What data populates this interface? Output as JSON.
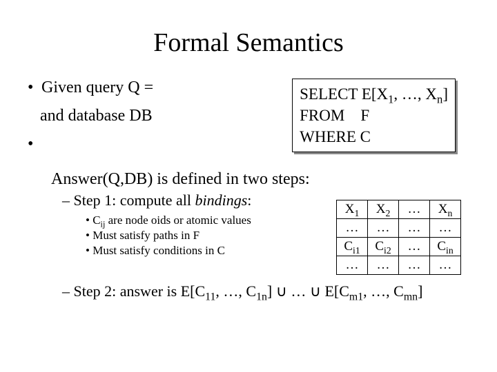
{
  "title": "Formal Semantics",
  "given_query": "Given query Q =",
  "and_database": "and database DB",
  "sql": {
    "select_kw": "SELECT",
    "select_expr_pre": "E[X",
    "select_expr_mid": ", …, X",
    "select_expr_post": "]",
    "from_kw": "FROM",
    "from_val": "F",
    "where_kw": "WHERE",
    "where_val": "C"
  },
  "answer_line": "Answer(Q,DB) is defined in two steps:",
  "step1": {
    "label": "– Step 1: compute all ",
    "bindings": "bindings",
    "colon": ":",
    "sub_a_pre": "C",
    "sub_a_post": " are node oids or atomic values",
    "sub_b": "Must satisfy paths in F",
    "sub_c": "Must satisfy conditions in C"
  },
  "table": {
    "h1": "X",
    "h2": "X",
    "hdots": "…",
    "hn": "X",
    "r_dots": "…",
    "c1": "C",
    "c2": "C",
    "cdots": "…",
    "cn": "C"
  },
  "step2": {
    "label": "– Step 2: answer is E[C",
    "mid1": ", …, C",
    "close1": "]",
    "cup": " ∪ … ∪ ",
    "open2": "E[C",
    "mid2": ", …, C",
    "close2": "]"
  },
  "subscripts": {
    "one": "1",
    "two": "2",
    "n": "n",
    "ij": "ij",
    "i1": "i1",
    "i2": "i2",
    "in": "in",
    "e11": "11",
    "e1n": "1n",
    "em1": "m1",
    "emn": "mn"
  }
}
